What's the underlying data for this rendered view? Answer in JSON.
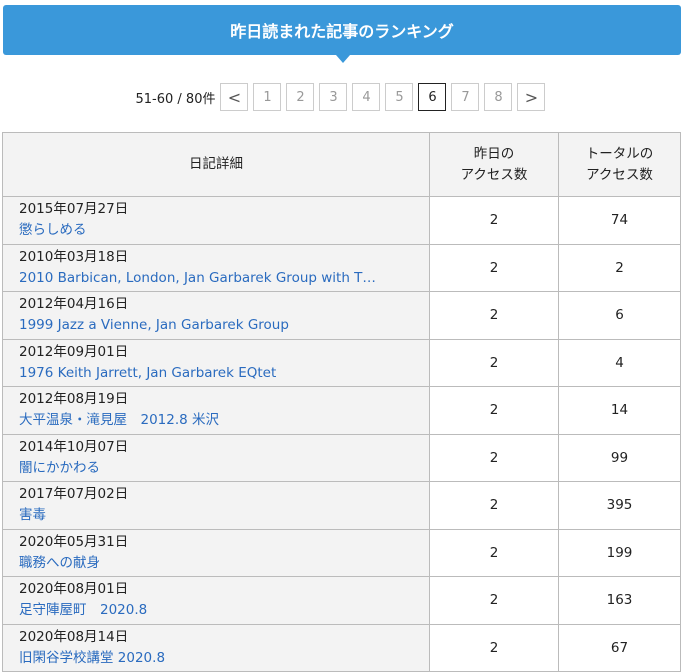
{
  "header": {
    "title": "昨日読まれた記事のランキング",
    "accent": "#3a98da"
  },
  "pagination": {
    "range": "51-60 / 80件",
    "prev": "<",
    "next": ">",
    "pages": [
      "1",
      "2",
      "3",
      "4",
      "5",
      "6",
      "7",
      "8"
    ],
    "current": "6"
  },
  "table": {
    "headers": {
      "detail": "日記詳細",
      "yesterday": "昨日の\nアクセス数",
      "total": "トータルの\nアクセス数"
    },
    "rows": [
      {
        "date": "2015年07月27日",
        "title": "懲らしめる",
        "yesterday": "2",
        "total": "74"
      },
      {
        "date": "2010年03月18日",
        "title": "2010 Barbican, London, Jan Garbarek Group with T…",
        "yesterday": "2",
        "total": "2"
      },
      {
        "date": "2012年04月16日",
        "title": "1999 Jazz a Vienne, Jan Garbarek Group",
        "yesterday": "2",
        "total": "6"
      },
      {
        "date": "2012年09月01日",
        "title": "1976 Keith Jarrett, Jan Garbarek EQtet",
        "yesterday": "2",
        "total": "4"
      },
      {
        "date": "2012年08月19日",
        "title": "大平温泉・滝見屋　2012.8 米沢",
        "yesterday": "2",
        "total": "14"
      },
      {
        "date": "2014年10月07日",
        "title": "闇にかかわる",
        "yesterday": "2",
        "total": "99"
      },
      {
        "date": "2017年07月02日",
        "title": "害毒",
        "yesterday": "2",
        "total": "395"
      },
      {
        "date": "2020年05月31日",
        "title": "職務への献身",
        "yesterday": "2",
        "total": "199"
      },
      {
        "date": "2020年08月01日",
        "title": "足守陣屋町　2020.8",
        "yesterday": "2",
        "total": "163"
      },
      {
        "date": "2020年08月14日",
        "title": "旧閑谷学校講堂 2020.8",
        "yesterday": "2",
        "total": "67"
      }
    ]
  }
}
